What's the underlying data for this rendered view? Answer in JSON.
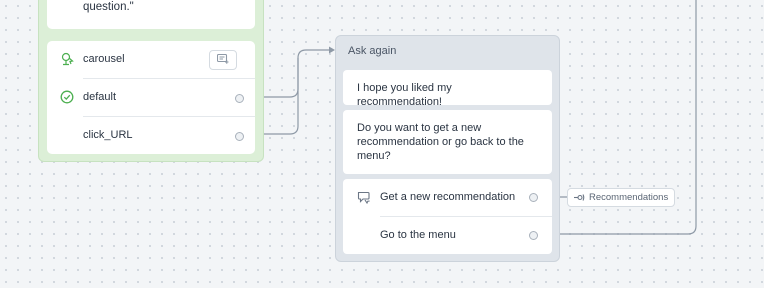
{
  "left_card": {
    "message_text": "why it matches the customers question.\"",
    "buttons": [
      {
        "label": "carousel",
        "icon": "carousel-icon"
      },
      {
        "label": "default",
        "icon": "check-circle-icon"
      },
      {
        "label": "click_URL",
        "icon": ""
      }
    ]
  },
  "ask_again": {
    "title": "Ask again",
    "messages": [
      "I hope you liked my recommendation!",
      "Do you want to get a new recommendation or go back to the menu?"
    ],
    "buttons": [
      {
        "label": "Get a new recommendation",
        "icon": "quick-reply-icon"
      },
      {
        "label": "Go to the menu",
        "icon": ""
      }
    ]
  },
  "target_tag": {
    "label": "Recommendations",
    "icon": "flow-link-icon"
  },
  "colors": {
    "canvas": "#f3f5f7",
    "left_card": "#dcefd7",
    "ask_card": "#dfe4ea",
    "connector": "#8e99a6",
    "success_green": "#4caf50"
  }
}
